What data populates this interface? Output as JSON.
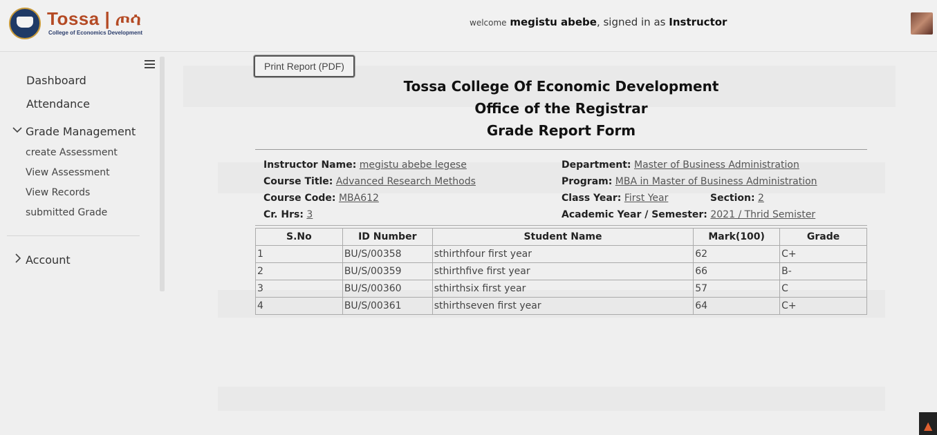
{
  "header": {
    "logo_name": "Tossa | ጦሳ",
    "logo_sub": "College of Economics Development",
    "welcome_prefix": "welcome",
    "user_name": "megistu abebe",
    "signed_in_text": ", signed in as",
    "role": "Instructor"
  },
  "sidebar": {
    "dashboard": "Dashboard",
    "attendance": "Attendance",
    "grade_management": "Grade Management",
    "grade_items": [
      "create Assessment",
      "View Assessment",
      "View Records",
      "submitted Grade"
    ],
    "account": "Account"
  },
  "report": {
    "print_button": "Print Report (PDF)",
    "title1": "Tossa College Of Economic Development",
    "title2": "Office of the Registrar",
    "title3": "Grade Report Form",
    "instructor_label": "Instructor Name:",
    "instructor_value": "megistu abebe legese",
    "course_title_label": "Course Title:",
    "course_title_value": "Advanced Research Methods",
    "course_code_label": "Course Code:",
    "course_code_value": "MBA612",
    "cr_hrs_label": "Cr. Hrs:",
    "cr_hrs_value": "3",
    "department_label": "Department:",
    "department_value": "Master of Business Administration",
    "program_label": "Program:",
    "program_value": "MBA in Master of Business Administration",
    "class_year_label": "Class Year:",
    "class_year_value": "First Year",
    "section_label": "Section:",
    "section_value": "2",
    "academic_label": "Academic Year / Semester:",
    "academic_value": "2021 / Thrid Semister",
    "columns": [
      "S.No",
      "ID Number",
      "Student Name",
      "Mark(100)",
      "Grade"
    ],
    "rows": [
      [
        "1",
        "BU/S/00358",
        "sthirthfour first year",
        "62",
        "C+"
      ],
      [
        "2",
        "BU/S/00359",
        "sthirthfive first year",
        "66",
        "B-"
      ],
      [
        "3",
        "BU/S/00360",
        "sthirthsix first year",
        "57",
        "C"
      ],
      [
        "4",
        "BU/S/00361",
        "sthirthseven first year",
        "64",
        "C+"
      ]
    ]
  },
  "icons": {
    "menu": "hamburger-icon",
    "expanded": "chevron-down-icon",
    "collapsed": "chevron-right-icon",
    "corner": "flame-icon"
  }
}
